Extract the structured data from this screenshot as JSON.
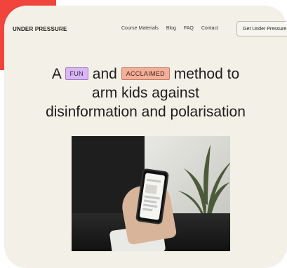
{
  "nav": {
    "brand": "UNDER PRESSURE",
    "links": [
      "Course Materials",
      "Blog",
      "FAQ",
      "Contact"
    ],
    "cta_label": "Get Under Pressure"
  },
  "hero": {
    "word_a": "A",
    "tag_fun": "FUN",
    "word_and": "and",
    "tag_acclaimed": "ACCLAIMED",
    "line1_tail": "method to",
    "line2": "arm kids against",
    "line3": "disinformation and polarisation"
  },
  "colors": {
    "accent_red": "#f0443d",
    "background": "#f3f0e7",
    "tag_fun_bg": "#d9b7f2",
    "tag_acclaimed_bg": "#f2b09b"
  }
}
